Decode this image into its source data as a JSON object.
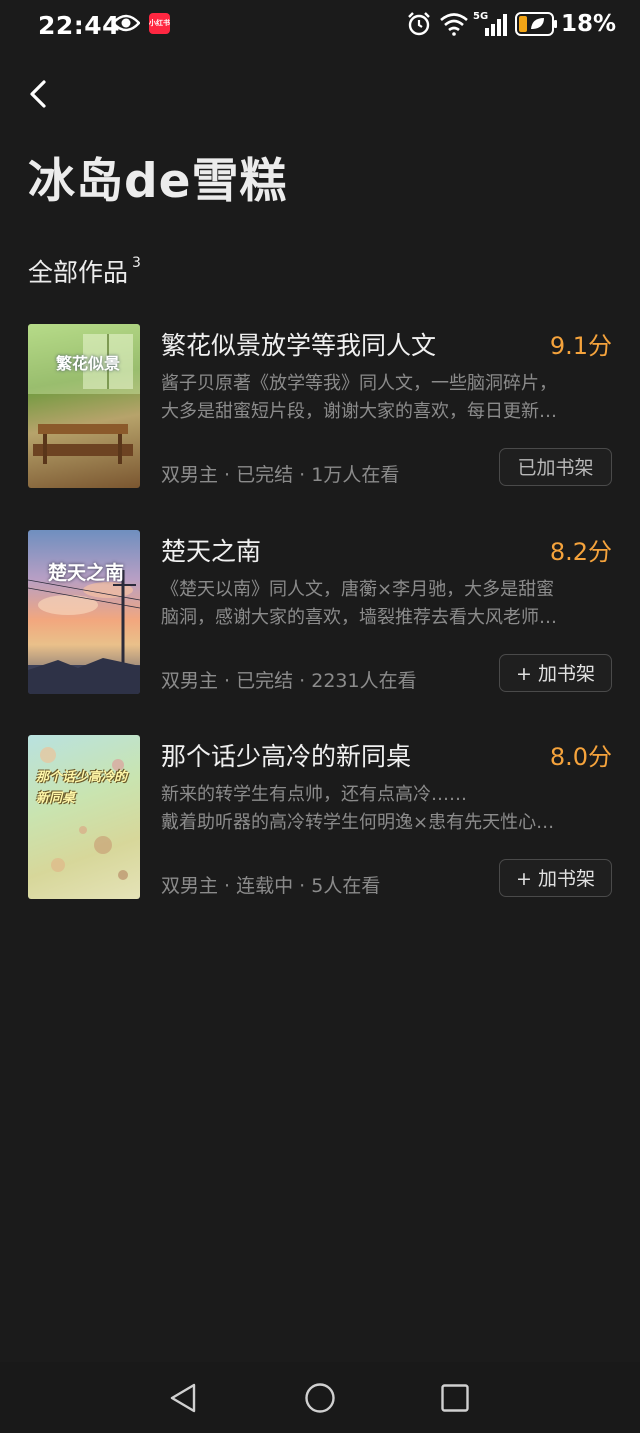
{
  "status_bar": {
    "time": "22:44",
    "app_badge": "小红书",
    "battery": "18%",
    "network": "5G"
  },
  "header": {
    "author_name": "冰岛de雪糕"
  },
  "section": {
    "title": "全部作品",
    "count": "3"
  },
  "books": [
    {
      "title": "繁花似景放学等我同人文",
      "score": "9.1分",
      "desc_line1": "酱子贝原著《放学等我》同人文，一些脑洞碎片，",
      "desc_line2": "大多是甜蜜短片段，谢谢大家的喜欢，每日更新…",
      "meta": "双男主 · 已完结 · 1万人在看",
      "shelf_label": "已加书架",
      "cover_title": "繁花似景"
    },
    {
      "title": "楚天之南",
      "score": "8.2分",
      "desc_line1": "《楚天以南》同人文，唐蘅×李月驰，大多是甜蜜",
      "desc_line2": "脑洞，感谢大家的喜欢，墙裂推荐去看大风老师…",
      "meta": "双男主 · 已完结 · 2231人在看",
      "shelf_label": "+ 加书架",
      "cover_title": "楚天之南"
    },
    {
      "title": "那个话少高冷的新同桌",
      "score": "8.0分",
      "desc_line1": "新来的转学生有点帅，还有点高冷……",
      "desc_line2": "戴着助听器的高冷转学生何明逸×患有先天性心…",
      "meta": "双男主 · 连载中 · 5人在看",
      "shelf_label": "+ 加书架",
      "cover_title": "那个话少高冷的新同桌"
    }
  ],
  "colors": {
    "background": "#1b1b1b",
    "score": "#f5a33c",
    "muted": "#8b8b8b"
  },
  "icons": [
    "back-arrow-icon",
    "eye-icon",
    "alarm-icon",
    "wifi-icon",
    "signal-icon",
    "battery-icon",
    "nav-back-icon",
    "nav-home-icon",
    "nav-recents-icon"
  ]
}
